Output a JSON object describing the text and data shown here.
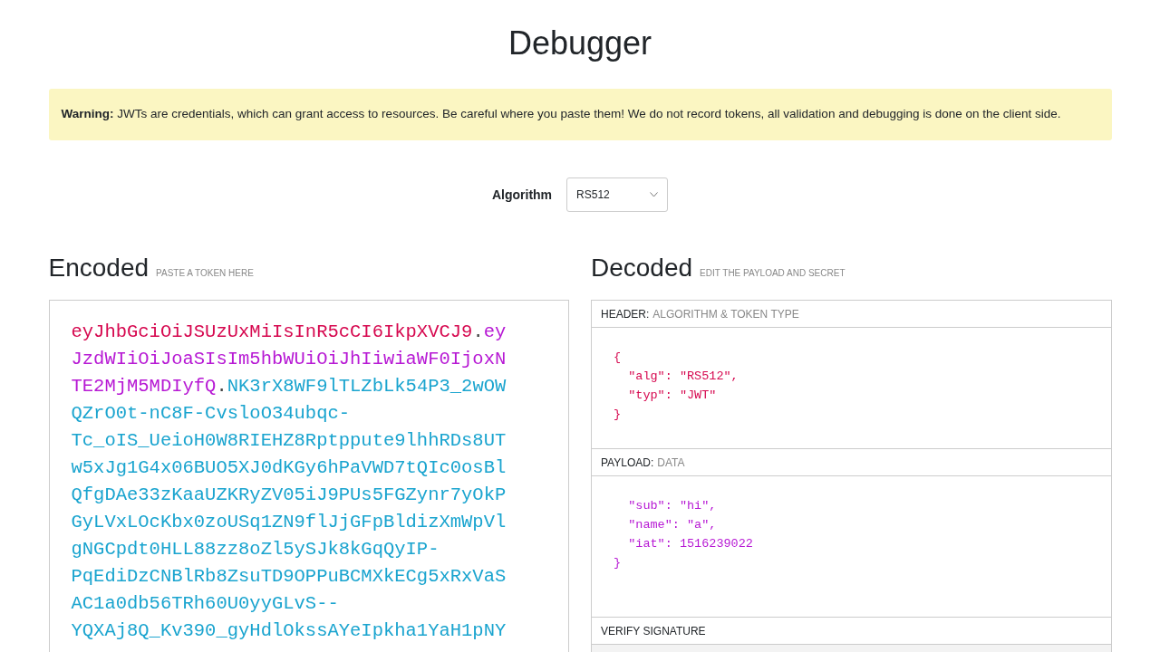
{
  "title": "Debugger",
  "warning": {
    "label": "Warning:",
    "text": "JWTs are credentials, which can grant access to resources. Be careful where you paste them! We do not record tokens, all validation and debugging is done on the client side."
  },
  "algorithm": {
    "label": "Algorithm",
    "value": "RS512"
  },
  "encoded": {
    "heading": "Encoded",
    "hint": "PASTE A TOKEN HERE",
    "lines": [
      [
        {
          "kind": "header",
          "text": "eyJhbGciOiJSUzUxMiIsInR5cCI6IkpXVCJ9"
        },
        {
          "kind": "separator",
          "text": "."
        },
        {
          "kind": "payload",
          "text": "ey"
        }
      ],
      [
        {
          "kind": "payload",
          "text": "JzdWIiOiJoaSIsIm5hbWUiOiJhIiwiaWF0IjoxN"
        }
      ],
      [
        {
          "kind": "payload",
          "text": "TE2MjM5MDIyfQ"
        },
        {
          "kind": "separator",
          "text": "."
        },
        {
          "kind": "signature",
          "text": "NK3rX8WF9lTLZbLk54P3_2wOW"
        }
      ],
      [
        {
          "kind": "signature",
          "text": "QZrO0t-nC8F-CvsloO34ubqc-"
        }
      ],
      [
        {
          "kind": "signature",
          "text": "Tc_oIS_UeioH0W8RIEHZ8Rptppute9lhhRDs8UT"
        }
      ],
      [
        {
          "kind": "signature",
          "text": "w5xJg1G4x06BUO5XJ0dKGy6hPaVWD7tQIc0osBl"
        }
      ],
      [
        {
          "kind": "signature",
          "text": "QfgDAe33zKaaUZKRyZV05iJ9PUs5FGZynr7yOkP"
        }
      ],
      [
        {
          "kind": "signature",
          "text": "GyLVxLOcKbx0zoUSq1ZN9flJjGFpBldizXmWpVl"
        }
      ],
      [
        {
          "kind": "signature",
          "text": "gNGCpdt0HLL88zz8oZl5ySJk8kGqQyIP-"
        }
      ],
      [
        {
          "kind": "signature",
          "text": "PqEdiDzCNBlRb8ZsuTD9OPPuBCMXkECg5xRxVaS"
        }
      ],
      [
        {
          "kind": "signature",
          "text": "AC1a0db56TRh60U0yyGLvS--"
        }
      ],
      [
        {
          "kind": "signature",
          "text": "YQXAj8Q_Kv390_gyHdlOkssAYeIpkha1YaH1pNY"
        }
      ]
    ]
  },
  "decoded": {
    "heading": "Decoded",
    "hint": "EDIT THE PAYLOAD AND SECRET",
    "sections": [
      {
        "kind": "header",
        "title": "HEADER:",
        "subtitle": "ALGORITHM & TOKEN TYPE",
        "lines": [
          "{",
          "  \"alg\": \"RS512\",",
          "  \"typ\": \"JWT\"",
          "}"
        ]
      },
      {
        "kind": "payload",
        "title": "PAYLOAD:",
        "subtitle": "DATA",
        "lines": [
          "  \"sub\": \"hi\",",
          "  \"name\": \"a\",",
          "  \"iat\": 1516239022",
          "}"
        ]
      },
      {
        "kind": "signature",
        "title": "VERIFY SIGNATURE"
      }
    ]
  }
}
